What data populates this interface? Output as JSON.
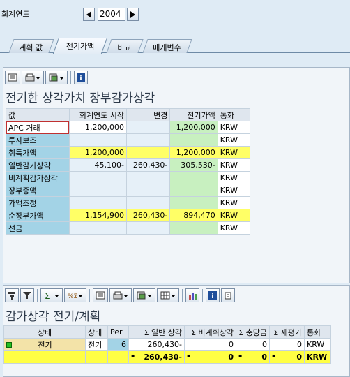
{
  "header": {
    "year_label": "회계연도",
    "year_value": "2004",
    "prev_icon": "triangle-left-icon",
    "next_icon": "triangle-right-icon"
  },
  "tabs": [
    {
      "label": "계획 값",
      "active": false
    },
    {
      "label": "전기가액",
      "active": true
    },
    {
      "label": "비교",
      "active": false
    },
    {
      "label": "매개변수",
      "active": false
    }
  ],
  "panel1": {
    "title": "전기한 상각가치 장부감가상각",
    "columns": [
      "값",
      "회계연도 시작",
      "변경",
      "전기가액",
      "통화"
    ],
    "rows": [
      {
        "label": "APC 거래",
        "start": "1,200,000",
        "change": "",
        "posted": "1,200,000",
        "currency": "KRW",
        "style": "white"
      },
      {
        "label": "투자보조",
        "start": "",
        "change": "",
        "posted": "",
        "currency": "KRW",
        "style": "white"
      },
      {
        "label": "취득가액",
        "start": "1,200,000",
        "change": "",
        "posted": "1,200,000",
        "currency": "KRW",
        "style": "yellow"
      },
      {
        "label": "일반감가상각",
        "start": "45,100-",
        "change": "260,430-",
        "posted": "305,530-",
        "currency": "KRW",
        "style": "white"
      },
      {
        "label": "비계획감가상각",
        "start": "",
        "change": "",
        "posted": "",
        "currency": "KRW",
        "style": "white"
      },
      {
        "label": "장부증액",
        "start": "",
        "change": "",
        "posted": "",
        "currency": "KRW",
        "style": "white"
      },
      {
        "label": "가액조정",
        "start": "",
        "change": "",
        "posted": "",
        "currency": "KRW",
        "style": "white"
      },
      {
        "label": "순장부가액",
        "start": "1,154,900",
        "change": "260,430-",
        "posted": "894,470",
        "currency": "KRW",
        "style": "yellow"
      },
      {
        "label": "선금",
        "start": "",
        "change": "",
        "posted": "",
        "currency": "KRW",
        "style": "white"
      }
    ]
  },
  "panel2": {
    "title": "감가상각 전기/계획",
    "columns": [
      "상태",
      "상태",
      "Per",
      "Σ 일반 상각",
      "Σ 비계획상각",
      "Σ 충당금",
      "Σ 재평가",
      "통화"
    ],
    "rows": [
      {
        "status_icon": "green-square-icon",
        "status": "전기",
        "status2": "전기",
        "per": "6",
        "ord": "260,430-",
        "unpl": "0",
        "reserve": "0",
        "reval": "0",
        "currency": "KRW"
      }
    ],
    "total": {
      "dot": "▪",
      "ord": "260,430-",
      "unpl": "0",
      "reserve": "0",
      "reval": "0",
      "currency": "KRW"
    }
  }
}
